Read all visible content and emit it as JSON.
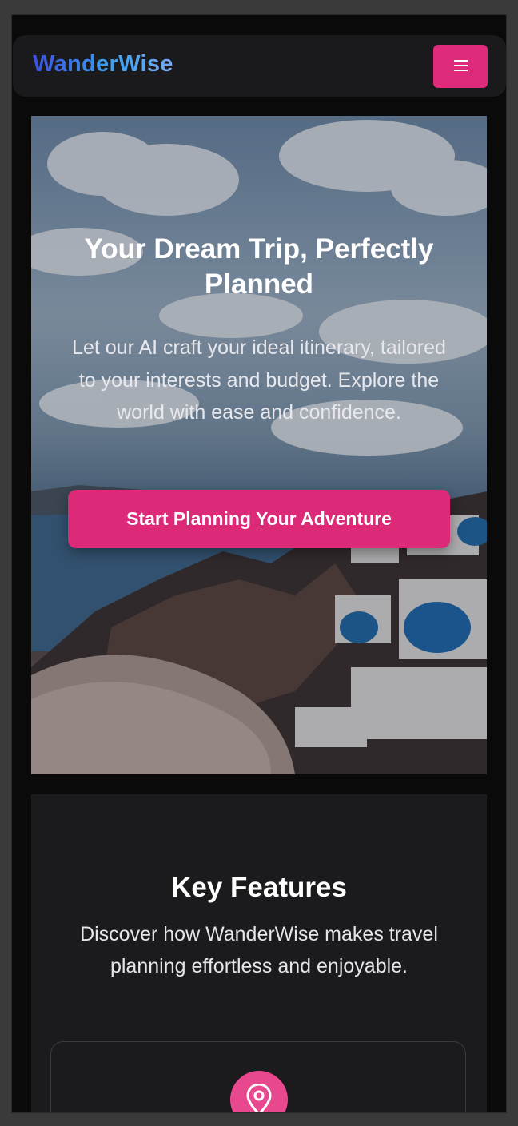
{
  "nav": {
    "logo": "WanderWise",
    "menu_icon": "hamburger-menu-icon",
    "menu_color": "#de2a7b"
  },
  "hero": {
    "title": "Your Dream Trip, Perfectly Planned",
    "subtitle": "Let our AI craft your ideal itinerary, tailored to your interests and budget. Explore the world with ease and confidence.",
    "cta_label": "Start Planning Your Adventure",
    "background": "santorini-coast-photo"
  },
  "features": {
    "title": "Key Features",
    "subtitle": "Discover how WanderWise makes travel planning effortless and enjoyable.",
    "cards": [
      {
        "icon": "map-pin-icon"
      }
    ]
  },
  "colors": {
    "accent": "#de2a7b",
    "logo_gradient_start": "#3b50e0",
    "logo_gradient_end": "#7aa8f0",
    "card_bg": "#1b1b1d",
    "page_bg": "#0a0a0b"
  }
}
